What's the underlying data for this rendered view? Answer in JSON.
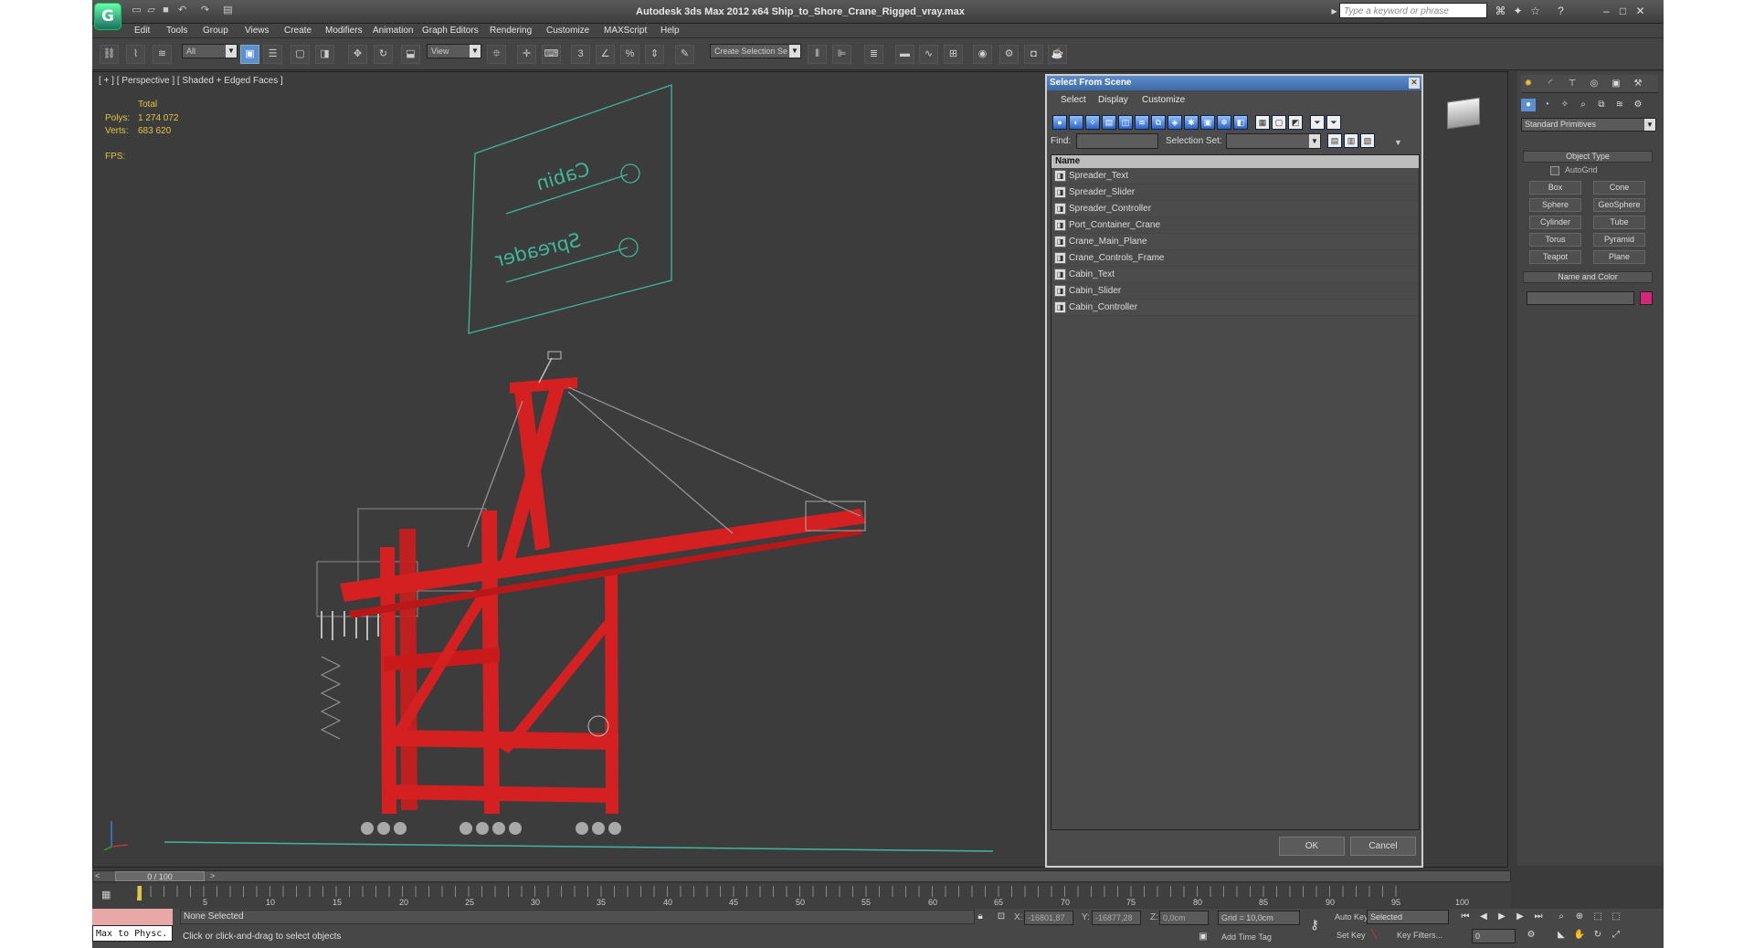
{
  "window": {
    "title": "Autodesk 3ds Max  2012 x64    Ship_to_Shore_Crane_Rigged_vray.max",
    "search_placeholder": "Type a keyword or phrase"
  },
  "menu": [
    "Edit",
    "Tools",
    "Group",
    "Views",
    "Create",
    "Modifiers",
    "Animation",
    "Graph Editors",
    "Rendering",
    "Customize",
    "MAXScript",
    "Help"
  ],
  "toolbar": {
    "filter_value": "All",
    "refcoord_value": "View",
    "selection_set_value": "Create Selection Se"
  },
  "viewport": {
    "label": "[ + ] [ Perspective ] [ Shaded + Edged Faces ]",
    "stats": {
      "total_label": "Total",
      "polys_label": "Polys:",
      "polys": "1 274 072",
      "verts_label": "Verts:",
      "verts": "683 620",
      "fps_label": "FPS:"
    },
    "board_text_1": "Cabin",
    "board_text_2": "Spreader"
  },
  "command_panel": {
    "category": "Standard Primitives",
    "object_type_title": "Object Type",
    "autogrid": "AutoGrid",
    "buttons": [
      "Box",
      "Cone",
      "Sphere",
      "GeoSphere",
      "Cylinder",
      "Tube",
      "Torus",
      "Pyramid",
      "Teapot",
      "Plane"
    ],
    "name_color_title": "Name and Color",
    "color": "#d4267a"
  },
  "dialog": {
    "title": "Select From Scene",
    "menu": [
      "Select",
      "Display",
      "Customize"
    ],
    "find_label": "Find:",
    "selection_set_label": "Selection Set:",
    "column_name": "Name",
    "items": [
      "Spreader_Text",
      "Spreader_Slider",
      "Spreader_Controller",
      "Port_Container_Crane",
      "Crane_Main_Plane",
      "Crane_Controls_Frame",
      "Cabin_Text",
      "Cabin_Slider",
      "Cabin_Controller"
    ],
    "ok": "OK",
    "cancel": "Cancel"
  },
  "timeline": {
    "slider_text": "0 / 100",
    "ticks": [
      "5",
      "10",
      "15",
      "20",
      "25",
      "30",
      "35",
      "40",
      "45",
      "50",
      "55",
      "60",
      "65",
      "70",
      "75",
      "80",
      "85",
      "90",
      "95",
      "100"
    ]
  },
  "status": {
    "script_label": "Max to Physc.",
    "selection": "None Selected",
    "prompt": "Click or click-and-drag to select objects",
    "x_label": "X:",
    "x": "-16801,87",
    "y_label": "Y:",
    "y": "-16877,28",
    "z_label": "Z:",
    "z": "0,0cm",
    "grid": "Grid = 10,0cm",
    "add_time_tag": "Add Time Tag",
    "auto_key": "Auto Key",
    "set_key": "Set Key",
    "key_mode": "Selected",
    "key_filters": "Key Filters...",
    "frame": "0"
  },
  "colors": {
    "crane": "#d42020",
    "wire": "#9a9a9a",
    "board": "#3fb89a",
    "stats": "#e0c640",
    "accent": "#3a6aa9"
  }
}
